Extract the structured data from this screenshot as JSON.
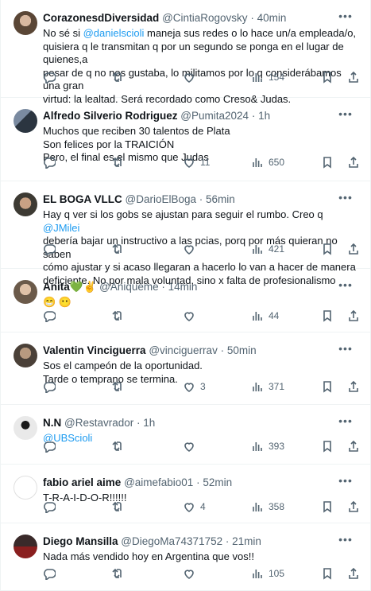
{
  "tweets": [
    {
      "name": "CorazonesdDiversidad",
      "handle": "@CintiaRogovsky",
      "time": "40min",
      "lines": [
        {
          "pre": "No sé si ",
          "mention": "@danielscioli",
          "post": " maneja sus redes o lo hace un/a empleada/o,"
        },
        {
          "pre": "quisiera q le transmitan q por un segundo se ponga en el lugar de quienes,a",
          "mention": "",
          "post": ""
        },
        {
          "pre": "pesar de q no nos gustaba, lo militamos  por lo q considerábamos una gran",
          "mention": "",
          "post": ""
        },
        {
          "pre": "virtud: la lealtad. Será recordado como Creso& Judas.",
          "mention": "",
          "post": ""
        }
      ],
      "likes": "",
      "views": "154"
    },
    {
      "name": "Alfredo Silverio Rodriguez",
      "handle": "@Pumita2024",
      "time": "1h",
      "lines": [
        {
          "pre": "Muchos que reciben 30 talentos de Plata",
          "mention": "",
          "post": ""
        },
        {
          "pre": "Son felices por la TRAICIÓN",
          "mention": "",
          "post": ""
        },
        {
          "pre": "Pero, el final es el mismo que Judas",
          "mention": "",
          "post": ""
        }
      ],
      "likes": "11",
      "views": "650"
    },
    {
      "name": "EL BOGA VLLC",
      "handle": "@DarioElBoga",
      "time": "56min",
      "lines": [
        {
          "pre": "Hay q ver si los gobs se ajustan para seguir el rumbo. Creo q ",
          "mention": "@JMilei",
          "post": ""
        },
        {
          "pre": "debería bajar un instructivo a las pcias, porq por más quieran no saben",
          "mention": "",
          "post": ""
        },
        {
          "pre": "cómo ajustar y si acaso llegaran a hacerlo lo van a hacer de manera",
          "mention": "",
          "post": ""
        },
        {
          "pre": "deficiente. No por mala voluntad, sino x falta de profesionalismo",
          "mention": "",
          "post": ""
        }
      ],
      "likes": "",
      "views": "421"
    },
    {
      "name": "Anita💚✌️",
      "handle": "@Aniqueme",
      "time": "14min",
      "lines": [
        {
          "pre": "😁 😶",
          "mention": "",
          "post": ""
        }
      ],
      "likes": "",
      "views": "44"
    },
    {
      "name": "Valentin Vinciguerra",
      "handle": "@vinciguerrav",
      "time": "50min",
      "lines": [
        {
          "pre": "Sos el campeón de la oportunidad.",
          "mention": "",
          "post": ""
        },
        {
          "pre": "Tarde o temprano se termina.",
          "mention": "",
          "post": ""
        }
      ],
      "likes": "3",
      "views": "371"
    },
    {
      "name": "N.N",
      "handle": "@Restavrador",
      "time": "1h",
      "lines": [
        {
          "pre": "",
          "mention": "@UBScioli",
          "post": ""
        }
      ],
      "likes": "",
      "views": "393"
    },
    {
      "name": "fabio ariel aime",
      "handle": "@aimefabio01",
      "time": "52min",
      "lines": [
        {
          "pre": "T-R-A-I-D-O-R!!!!!!",
          "mention": "",
          "post": ""
        }
      ],
      "likes": "4",
      "views": "358"
    },
    {
      "name": "Diego Mansilla",
      "handle": "@DiegoMa74371752",
      "time": "21min",
      "lines": [
        {
          "pre": "Nada más vendido hoy en Argentina que vos!!",
          "mention": "",
          "post": ""
        }
      ],
      "likes": "",
      "views": "105"
    }
  ],
  "separator": " · ",
  "icons": [
    "more-icon",
    "reply-icon",
    "retweet-icon",
    "like-icon",
    "views-icon",
    "bookmark-icon",
    "share-icon"
  ],
  "colors": {
    "mention": "#1d9bf0",
    "text": "#0f1419",
    "muted": "#536471",
    "border": "#eff3f4"
  }
}
